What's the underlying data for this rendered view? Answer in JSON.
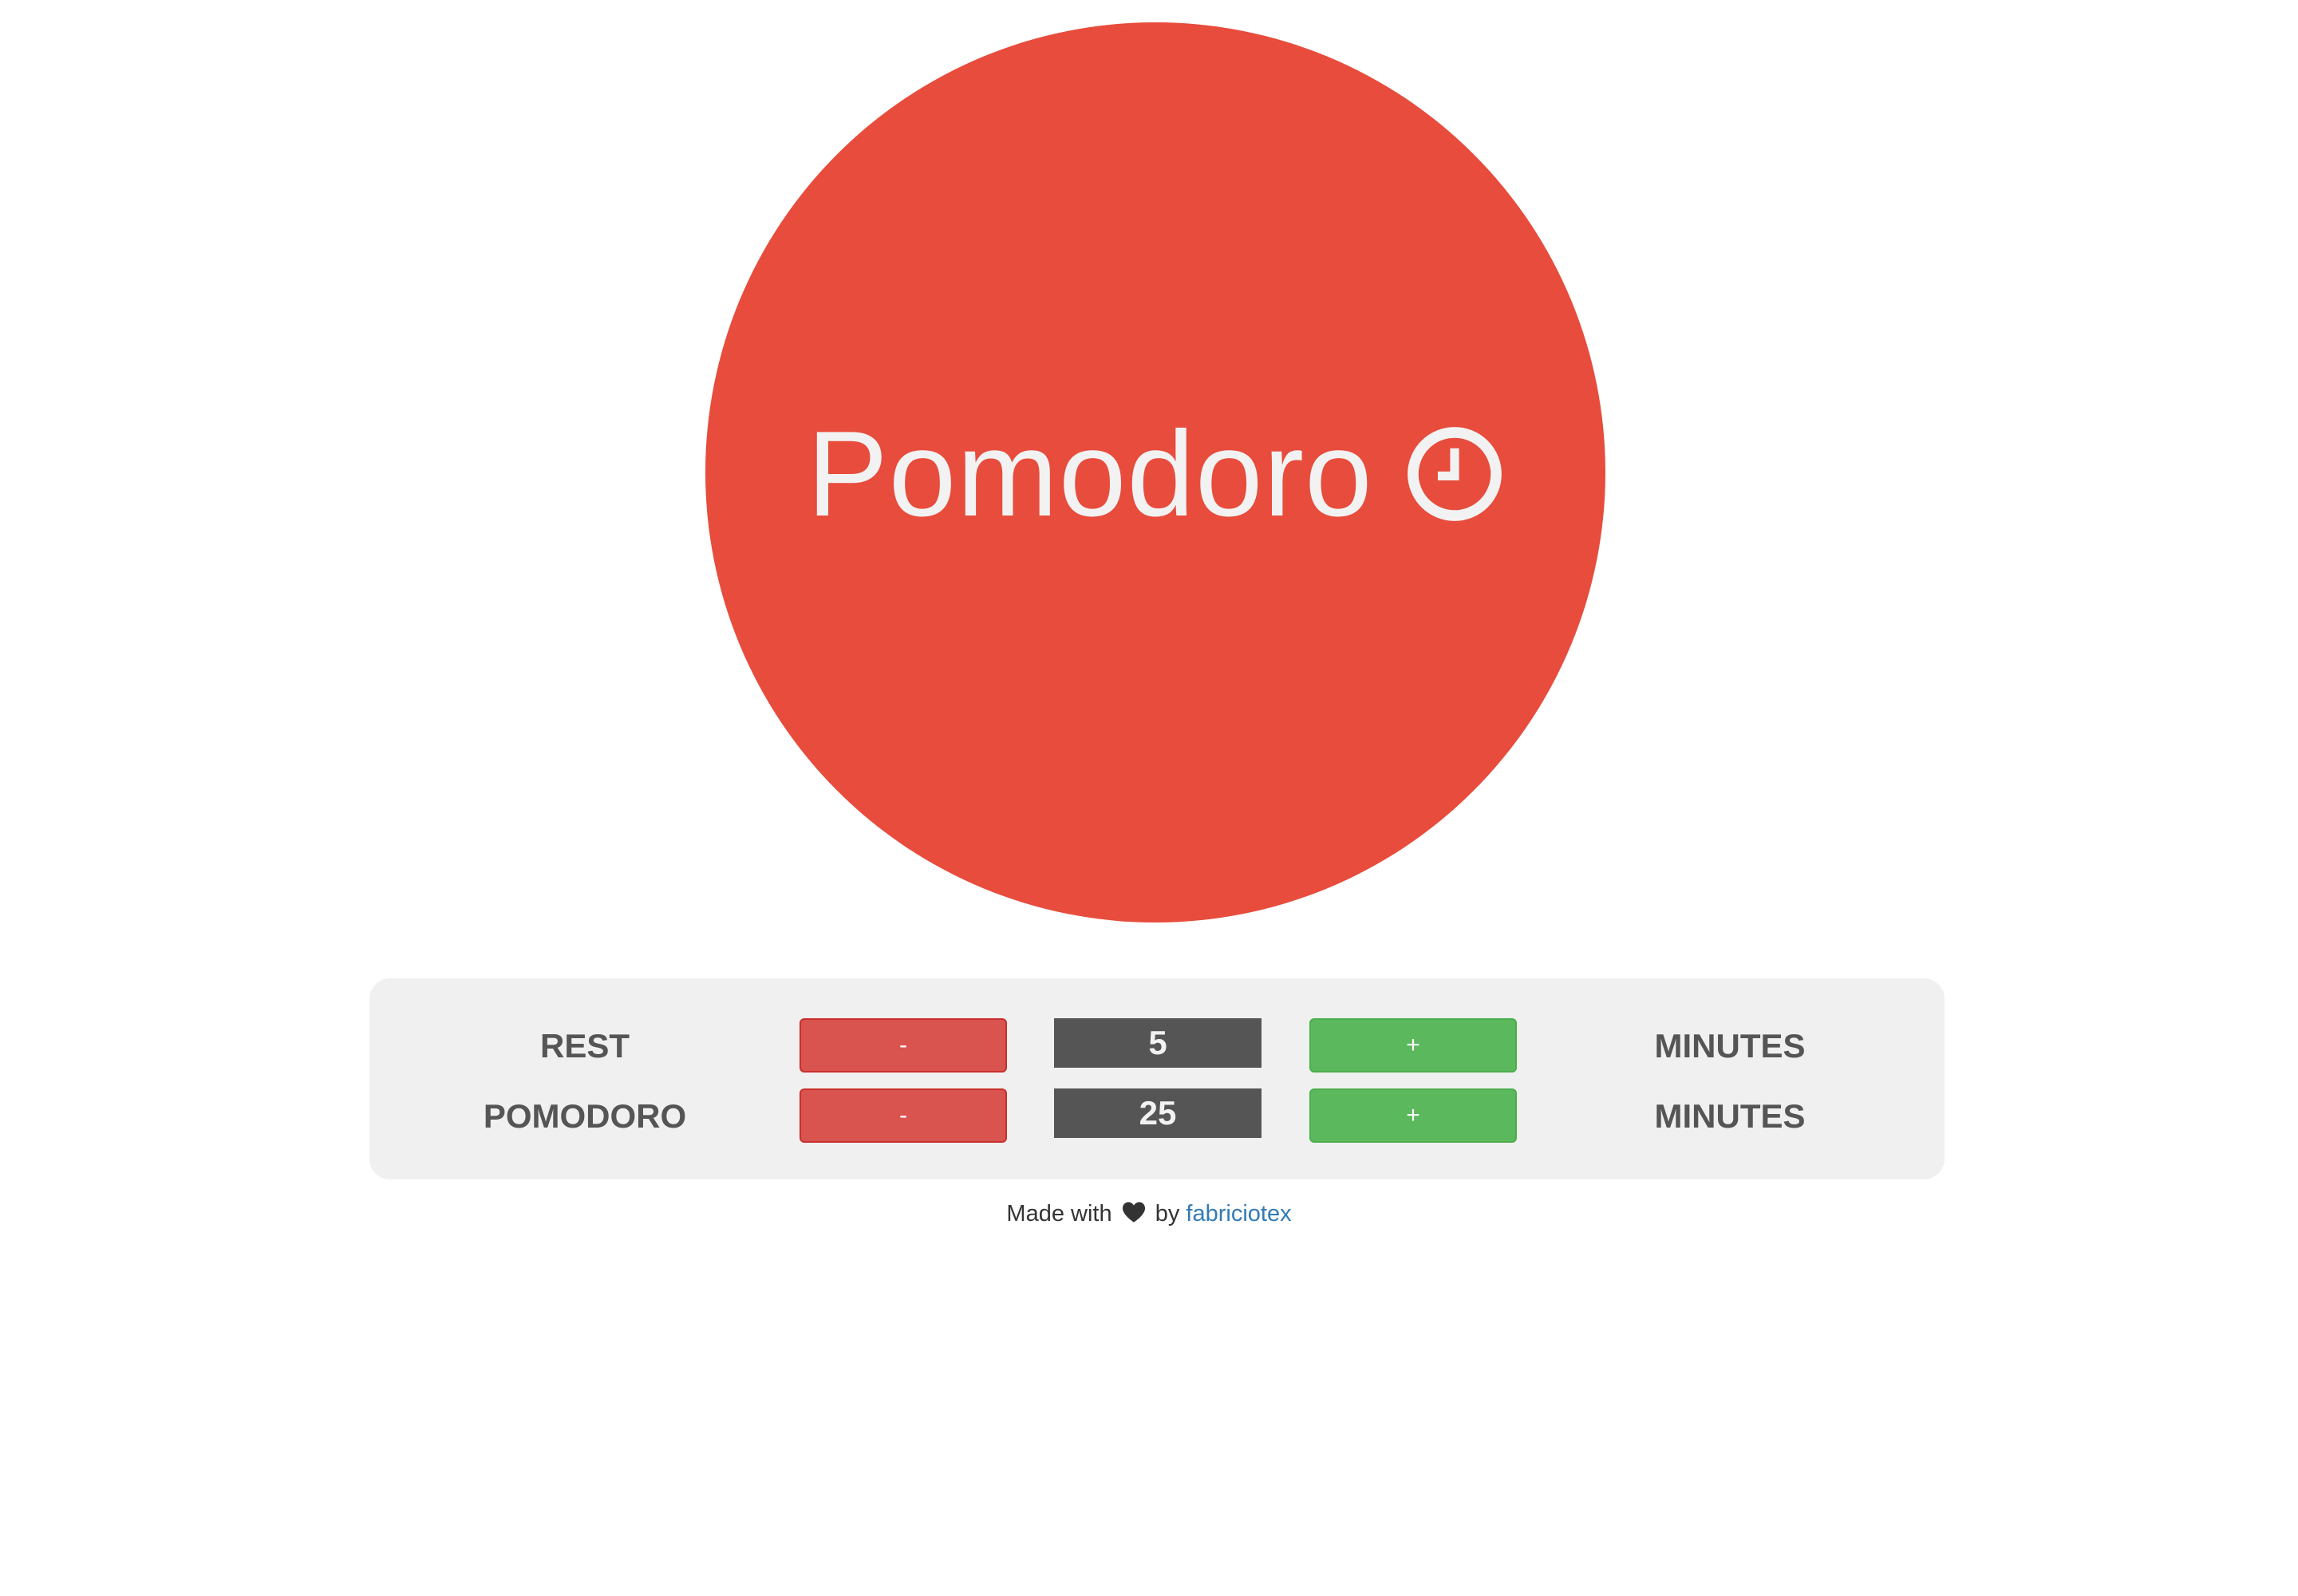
{
  "timer": {
    "title": "Pomodoro",
    "icon": "clock-icon",
    "color": "#e74c3c"
  },
  "settings": {
    "rows": [
      {
        "label": "REST",
        "minus_label": "-",
        "value": "5",
        "plus_label": "+",
        "unit": "MINUTES"
      },
      {
        "label": "POMODORO",
        "minus_label": "-",
        "value": "25",
        "plus_label": "+",
        "unit": "MINUTES"
      }
    ]
  },
  "footer": {
    "prefix": "Made with",
    "icon": "heart-icon",
    "middle": "by",
    "author": "fabriciotex",
    "link_color": "#337ab7"
  },
  "colors": {
    "minus_button": "#d9534f",
    "plus_button": "#5cb85c",
    "value_box": "#555555",
    "panel": "#f0f0f0"
  }
}
